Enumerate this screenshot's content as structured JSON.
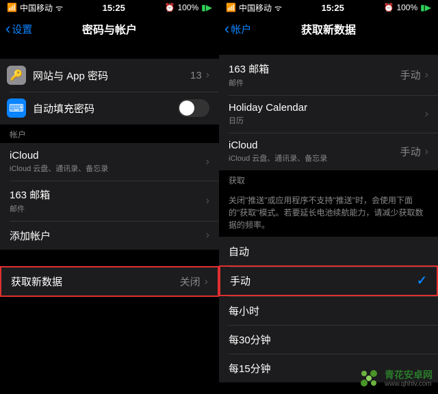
{
  "status": {
    "carrier": "中国移动",
    "time": "15:25",
    "battery": "100%"
  },
  "left": {
    "back": "设置",
    "title": "密码与帐户",
    "web_app_pwd": "网站与 App 密码",
    "web_app_count": "13",
    "autofill": "自动填充密码",
    "accounts_header": "帐户",
    "icloud": {
      "title": "iCloud",
      "sub": "iCloud 云盘、通讯录、备忘录"
    },
    "mail163": {
      "title": "163 邮箱",
      "sub": "邮件"
    },
    "add_account": "添加帐户",
    "fetch": {
      "label": "获取新数据",
      "value": "关闭"
    }
  },
  "right": {
    "back": "帐户",
    "title": "获取新数据",
    "mail163": {
      "title": "163 邮箱",
      "sub": "邮件",
      "mode": "手动"
    },
    "holiday": {
      "title": "Holiday Calendar",
      "sub": "日历"
    },
    "icloud": {
      "title": "iCloud",
      "sub": "iCloud 云盘、通讯录、备忘录",
      "mode": "手动"
    },
    "fetch_header": "获取",
    "fetch_footer": "关闭\"推送\"或应用程序不支持\"推送\"时，会使用下面的\"获取\"模式。若要延长电池续航能力，请减少获取数据的频率。",
    "opts": {
      "auto": "自动",
      "manual": "手动",
      "hourly": "每小时",
      "every30": "每30分钟",
      "every15": "每15分钟"
    }
  },
  "watermark": {
    "brand": "青花安卓网",
    "url": "www.qhhlv.com"
  }
}
